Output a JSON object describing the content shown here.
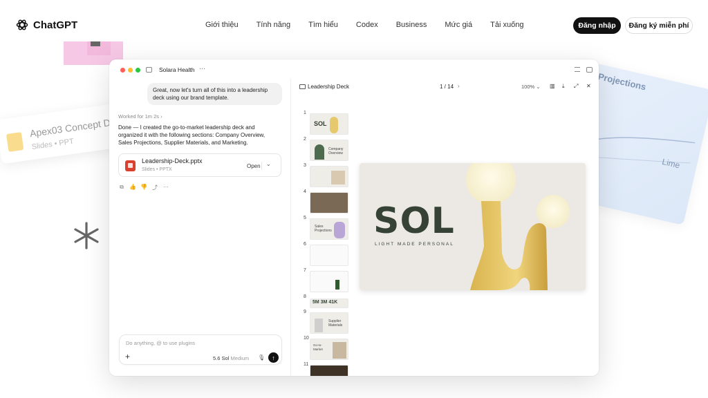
{
  "nav": {
    "brand": "ChatGPT",
    "links": [
      "Giới thiệu",
      "Tính năng",
      "Tìm hiểu",
      "Codex",
      "Business",
      "Mức giá",
      "Tải xuống"
    ],
    "login": "Đăng nhập",
    "signup": "Đăng ký miễn phí"
  },
  "bg_cards": {
    "left_title": "Apex03 Concept D",
    "left_meta": "Slides • PPT",
    "right_title": "Projections",
    "right_text": "Lime"
  },
  "window": {
    "title": "Solara Health",
    "more": "···"
  },
  "chat": {
    "user_message": "Great, now let's turn all of this into a leadership deck using our brand template.",
    "worked": "Worked for 1m 2s ›",
    "assistant_message": "Done — I created the go-to-market leadership deck and organized it with the following sections: Company Overview, Sales Projections, Supplier Materials, and Marketing.",
    "file": {
      "name": "Leadership-Deck.pptx",
      "meta": "Slides • PPTX",
      "open": "Open",
      "chevron": "⌄"
    },
    "actions": [
      "⧉",
      "👍",
      "👎",
      "⤴",
      "···"
    ],
    "composer": {
      "placeholder": "Do anything, @ to use plugins",
      "plus": "+",
      "model": "5.6 Sol",
      "model_sub": "Medium",
      "mic": "🎙",
      "send": "↑"
    }
  },
  "deck": {
    "title": "Leadership Deck",
    "page": "1 / 14",
    "next": "›",
    "zoom": "100% ⌄",
    "icons": [
      "▥",
      "⤓",
      "⤢",
      "✕"
    ],
    "thumbs": [
      {
        "n": "1",
        "label": "SOL"
      },
      {
        "n": "2",
        "label": "Company Overview"
      },
      {
        "n": "3",
        "label": ""
      },
      {
        "n": "4",
        "label": ""
      },
      {
        "n": "5",
        "label": "Sales Projections"
      },
      {
        "n": "6",
        "label": ""
      },
      {
        "n": "7",
        "label": ""
      },
      {
        "n": "8",
        "label": "5M 3M 41K"
      },
      {
        "n": "9",
        "label": "Supplier Materials"
      },
      {
        "n": "10",
        "label": "Go-to-Market"
      },
      {
        "n": "11",
        "label": ""
      }
    ],
    "slide": {
      "title": "SOL",
      "subtitle": "LIGHT MADE PERSONAL"
    }
  },
  "colors": {
    "accent_dark": "#111111",
    "slide_bg": "#ece8e3",
    "slide_text": "#354235",
    "lamp_yellow": "#e6c86d",
    "pink_deco": "#f7c8e6"
  }
}
